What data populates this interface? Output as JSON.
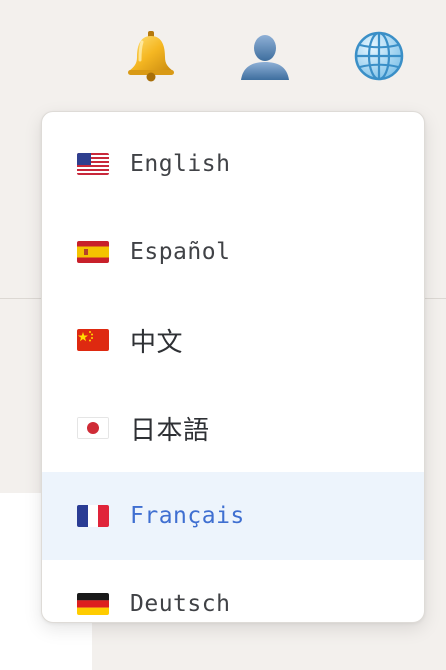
{
  "toolbar": {
    "notifications_icon": "bell-icon",
    "profile_icon": "user-icon",
    "language_icon": "globe-icon"
  },
  "language_menu": {
    "selected": "Français",
    "items": [
      {
        "label": "English",
        "flag": "us-flag-icon"
      },
      {
        "label": "Español",
        "flag": "spain-flag-icon"
      },
      {
        "label": "中文",
        "flag": "china-flag-icon"
      },
      {
        "label": "日本語",
        "flag": "japan-flag-icon"
      },
      {
        "label": "Français",
        "flag": "france-flag-icon"
      },
      {
        "label": "Deutsch",
        "flag": "germany-flag-icon"
      }
    ]
  },
  "colors": {
    "page_background": "#f3f0ed",
    "menu_background": "#ffffff",
    "selected_background": "#edf4fc",
    "selected_text": "#3f6fd1",
    "text": "#404246"
  }
}
